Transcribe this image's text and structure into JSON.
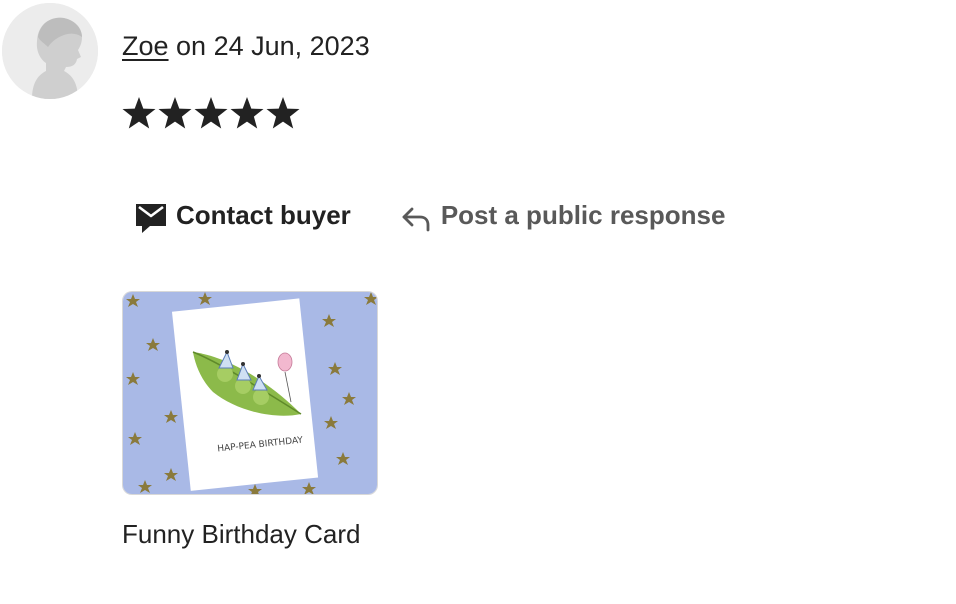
{
  "review": {
    "reviewer_name": "Zoe",
    "date_prefix": " on ",
    "date": "24 Jun, 2023",
    "rating": 5,
    "max_rating": 5
  },
  "actions": {
    "contact_label": "Contact buyer",
    "respond_label": "Post a public response"
  },
  "product": {
    "image_caption": "HAP-PEA BIRTHDAY",
    "title": "Funny Birthday Card"
  },
  "colors": {
    "text": "#222222",
    "muted_text": "#595959",
    "star": "#222222",
    "avatar_bg": "#ececec",
    "card_bg": "#a9b9e6"
  },
  "icons": {
    "avatar": "person-silhouette-icon",
    "star": "star-icon",
    "contact": "envelope-chat-icon",
    "respond": "reply-arrow-icon"
  }
}
